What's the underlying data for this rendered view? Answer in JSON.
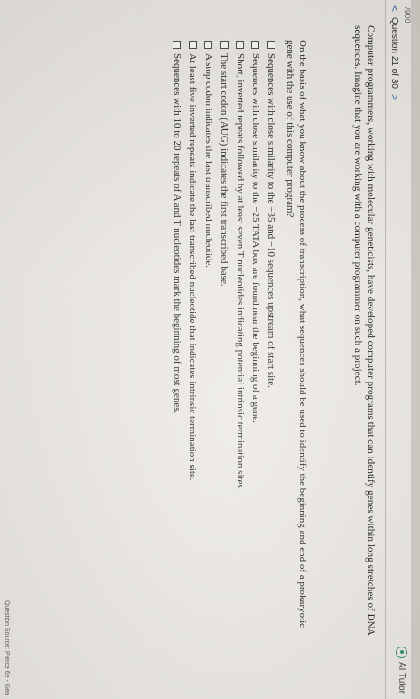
{
  "header": {
    "score": "/900",
    "question_label": "Question 21 of 30",
    "prev_glyph": "<",
    "next_glyph": ">",
    "ai_tutor_label": "AI Tutor"
  },
  "question": {
    "intro": "Computer programmers, working with molecular geneticists, have developed computer programs that can identify genes within long stretches of DNA sequences. Imagine that you are working with a computer programmer on such a project.",
    "prompt": "On the basis of what you know about the process of transcription, what sequences should be used to identify the beginning and end of a prokaryotic gene with the use of this computer program?",
    "options": [
      "Sequences with close similarity to the −35 and −10 sequences upstream of start site.",
      "Sequences with close similarity to the −25 TATA box are found near the beginning of a gene.",
      "Short, inverted repeats followed by at least seven T nucleotides indicating potential intrinsic termination sites.",
      "The start codon (AUG) indicates the first transcribed base.",
      "A stop codon indicates the last transcribed nucleotide.",
      "At least five inverted repeats indicate the last transcribed nucleotide that indicates intrinsic termination site.",
      "Sequences with 10 to 20 repeats of A and T nucleotides mark the beginning of most genes."
    ]
  },
  "footer": {
    "source": "Question Source: Pierce 6e - Gen"
  },
  "colors": {
    "link": "#2d5fa6",
    "ai_tutor": "#2a8a6b"
  }
}
